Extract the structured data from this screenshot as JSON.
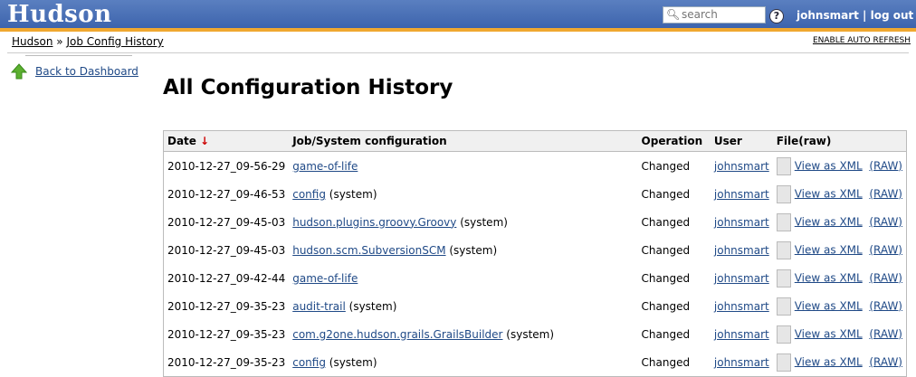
{
  "header": {
    "logo": "Hudson",
    "search_placeholder": "search",
    "help": "?",
    "user": "johnsmart",
    "separator": " | ",
    "logout": "log out"
  },
  "breadcrumb": {
    "home": "Hudson",
    "sep": " » ",
    "current": "Job Config History"
  },
  "auto_refresh": "ENABLE AUTO REFRESH",
  "sidebar": {
    "back": "Back to Dashboard"
  },
  "page_title": "All Configuration History",
  "table": {
    "headers": {
      "date": "Date",
      "sort_indicator": "↓",
      "config": "Job/System configuration",
      "operation": "Operation",
      "user": "User",
      "file": "File(raw)"
    },
    "rows": [
      {
        "date": "2010-12-27_09-56-29",
        "config": "game-of-life",
        "suffix": "",
        "operation": "Changed",
        "user": "johnsmart",
        "view": "View as XML",
        "raw": "(RAW)"
      },
      {
        "date": "2010-12-27_09-46-53",
        "config": "config",
        "suffix": " (system)",
        "operation": "Changed",
        "user": "johnsmart",
        "view": "View as XML",
        "raw": "(RAW)"
      },
      {
        "date": "2010-12-27_09-45-03",
        "config": "hudson.plugins.groovy.Groovy",
        "suffix": " (system)",
        "operation": "Changed",
        "user": "johnsmart",
        "view": "View as XML",
        "raw": "(RAW)"
      },
      {
        "date": "2010-12-27_09-45-03",
        "config": "hudson.scm.SubversionSCM",
        "suffix": " (system)",
        "operation": "Changed",
        "user": "johnsmart",
        "view": "View as XML",
        "raw": "(RAW)"
      },
      {
        "date": "2010-12-27_09-42-44",
        "config": "game-of-life",
        "suffix": "",
        "operation": "Changed",
        "user": "johnsmart",
        "view": "View as XML",
        "raw": "(RAW)"
      },
      {
        "date": "2010-12-27_09-35-23",
        "config": "audit-trail",
        "suffix": " (system)",
        "operation": "Changed",
        "user": "johnsmart",
        "view": "View as XML",
        "raw": "(RAW)"
      },
      {
        "date": "2010-12-27_09-35-23",
        "config": "com.g2one.hudson.grails.GrailsBuilder",
        "suffix": " (system)",
        "operation": "Changed",
        "user": "johnsmart",
        "view": "View as XML",
        "raw": "(RAW)"
      },
      {
        "date": "2010-12-27_09-35-23",
        "config": "config",
        "suffix": " (system)",
        "operation": "Changed",
        "user": "johnsmart",
        "view": "View as XML",
        "raw": "(RAW)"
      }
    ]
  }
}
